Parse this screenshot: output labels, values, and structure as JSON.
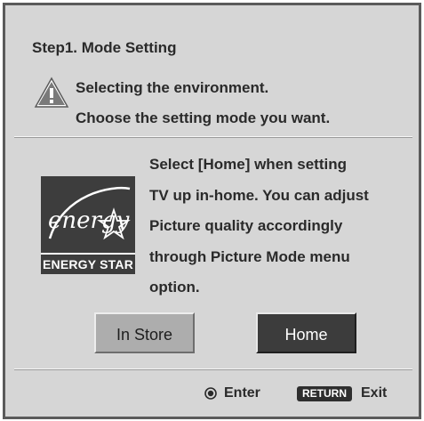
{
  "dialog": {
    "step_title": "Step1.  Mode Setting",
    "warning": {
      "icon": "warning-triangle-icon",
      "line1": "Selecting the environment.",
      "line2": "Choose the setting mode you want."
    },
    "logo": {
      "script_text": "energy",
      "caption": "ENERGY STAR"
    },
    "description": [
      "Select [Home] when setting",
      "TV up in-home. You can adjust",
      "Picture quality accordingly",
      "through Picture Mode menu",
      "option."
    ],
    "buttons": {
      "in_store": "In Store",
      "home": "Home",
      "selected": "Home"
    },
    "footer": {
      "enter_icon": "enter-circle-icon",
      "enter_label": "Enter",
      "return_key": "RETURN",
      "exit_label": "Exit"
    }
  },
  "colors": {
    "panel_bg": "#d6d6d6",
    "border": "#5b5b5b",
    "selected_button": "#3c3c3c",
    "unselected_button": "#adadad"
  }
}
